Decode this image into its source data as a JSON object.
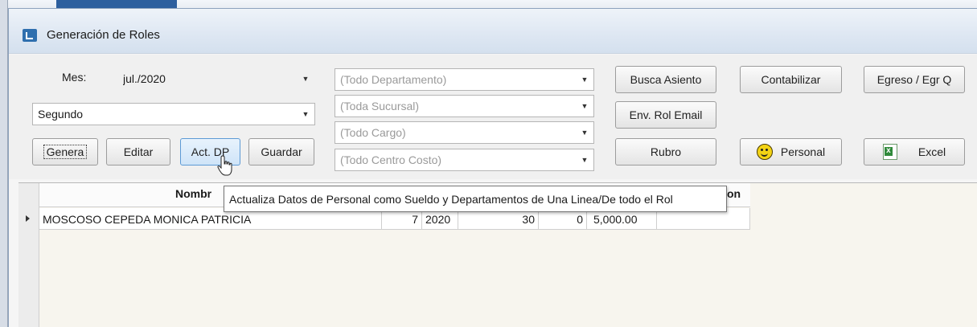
{
  "window": {
    "title": "Generación de Roles"
  },
  "form": {
    "mes_label": "Mes:",
    "mes_value": "jul./2020",
    "periodo_value": "Segundo",
    "departamento_placeholder": "(Todo Departamento)",
    "sucursal_placeholder": "(Toda Sucursal)",
    "cargo_placeholder": "(Todo Cargo)",
    "centro_costo_placeholder": "(Todo Centro Costo)"
  },
  "buttons": {
    "genera": "Genera",
    "editar": "Editar",
    "act_dp": "Act. DP",
    "guardar": "Guardar",
    "busca_asiento": "Busca Asiento",
    "env_rol_email": "Env. Rol Email",
    "rubro": "Rubro",
    "contabilizar": "Contabilizar",
    "personal": "Personal",
    "egreso": "Egreso / Egr Q",
    "excel": "Excel"
  },
  "grid": {
    "header_visible_left": "Nombr",
    "header_visible_right": "on",
    "rows": [
      {
        "nombre": "MOSCOSO CEPEDA MONICA PATRICIA",
        "mes": "7",
        "anio": "2020",
        "dias": "30",
        "col5": "0",
        "sueldo": "5,000.00"
      }
    ]
  },
  "tooltip": "Actualiza Datos de Personal como Sueldo y Departamentos de Una Linea/De todo el Rol",
  "icons": [
    "app-icon",
    "smiley-icon",
    "excel-icon",
    "cursor-icon",
    "dropdown-arrow-icon",
    "row-pointer-icon"
  ]
}
